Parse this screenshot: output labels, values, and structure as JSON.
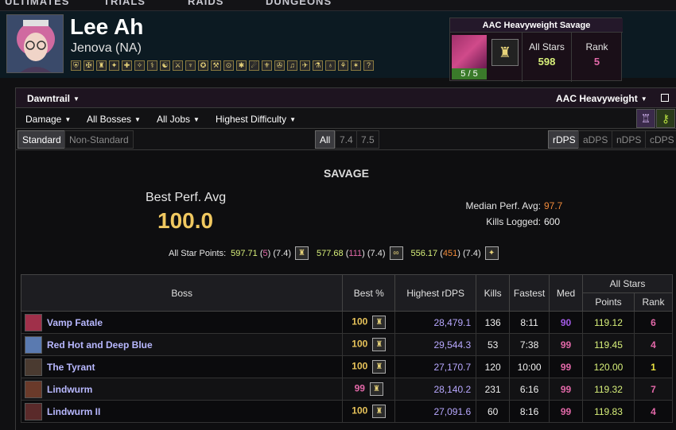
{
  "nav": {
    "tabs": [
      "ULTIMATES",
      "TRIALS",
      "RAIDS",
      "DUNGEONS"
    ]
  },
  "character": {
    "name": "Lee Ah",
    "server": "Jenova (NA)",
    "jobs": [
      "⛨",
      "✠",
      "♜",
      "✦",
      "✚",
      "✧",
      "⚕",
      "☯",
      "⚔",
      "♆",
      "✪",
      "⚒",
      "⊙",
      "✱",
      "☄",
      "⚜",
      "✇",
      "♫",
      "✈",
      "⚗",
      "♁",
      "⚘",
      "✶",
      "?"
    ]
  },
  "aac": {
    "title": "AAC Heavyweight Savage",
    "count": "5 / 5",
    "icon": "♜",
    "all_stars_label": "All Stars",
    "all_stars_value": "598",
    "rank_label": "Rank",
    "rank_value": "5"
  },
  "filters": {
    "expansion": "Dawntrail",
    "zone": "AAC Heavyweight",
    "metric": "Damage",
    "bosses": "All Bosses",
    "jobs": "All Jobs",
    "difficulty": "Highest Difficulty",
    "standard": "Standard",
    "non_standard": "Non-Standard",
    "patch_all": "All",
    "patch_1": "7.4",
    "patch_2": "7.5",
    "rdps": "rDPS",
    "adps": "aDPS",
    "ndps": "nDPS",
    "cdps": "cDPS"
  },
  "summary": {
    "difficulty": "SAVAGE",
    "best_perf_label": "Best Perf. Avg",
    "best_perf_value": "100.0",
    "median_label": "Median Perf. Avg:",
    "median_value": "97.7",
    "kills_label": "Kills Logged:",
    "kills_value": "600",
    "asp_label": "All Star Points:",
    "asp": [
      {
        "points": "597.71",
        "rank": "5",
        "patch": "(7.4)",
        "icon": "♜"
      },
      {
        "points": "577.68",
        "rank": "111",
        "patch": "(7.4)",
        "icon": "∞"
      },
      {
        "points": "556.17",
        "rank": "451",
        "patch": "(7.4)",
        "icon": "✦"
      }
    ]
  },
  "table": {
    "headers": {
      "boss": "Boss",
      "best": "Best %",
      "highest": "Highest rDPS",
      "kills": "Kills",
      "fastest": "Fastest",
      "med": "Med",
      "all_stars": "All Stars",
      "points": "Points",
      "rank": "Rank"
    },
    "rows": [
      {
        "boss": "Vamp Fatale",
        "best": "100",
        "rdps": "28,479.1",
        "kills": "136",
        "fastest": "8:11",
        "med": "90",
        "points": "119.12",
        "rank": "6"
      },
      {
        "boss": "Red Hot and Deep Blue",
        "best": "100",
        "rdps": "29,544.3",
        "kills": "53",
        "fastest": "7:38",
        "med": "99",
        "points": "119.45",
        "rank": "4"
      },
      {
        "boss": "The Tyrant",
        "best": "100",
        "rdps": "27,170.7",
        "kills": "120",
        "fastest": "10:00",
        "med": "99",
        "points": "120.00",
        "rank": "1"
      },
      {
        "boss": "Lindwurm",
        "best": "99",
        "rdps": "28,140.2",
        "kills": "231",
        "fastest": "6:16",
        "med": "99",
        "points": "119.32",
        "rank": "7"
      },
      {
        "boss": "Lindwurm II",
        "best": "100",
        "rdps": "27,091.6",
        "kills": "60",
        "fastest": "8:16",
        "med": "99",
        "points": "119.83",
        "rank": "4"
      }
    ]
  },
  "colors": {
    "gold": "#e7c35a",
    "pink": "#e268a8",
    "purple": "#a35be8",
    "orange": "#f08a3a",
    "yellow": "#e8e040",
    "green_points": "#d8f07a",
    "rank5": "#e268a8"
  }
}
